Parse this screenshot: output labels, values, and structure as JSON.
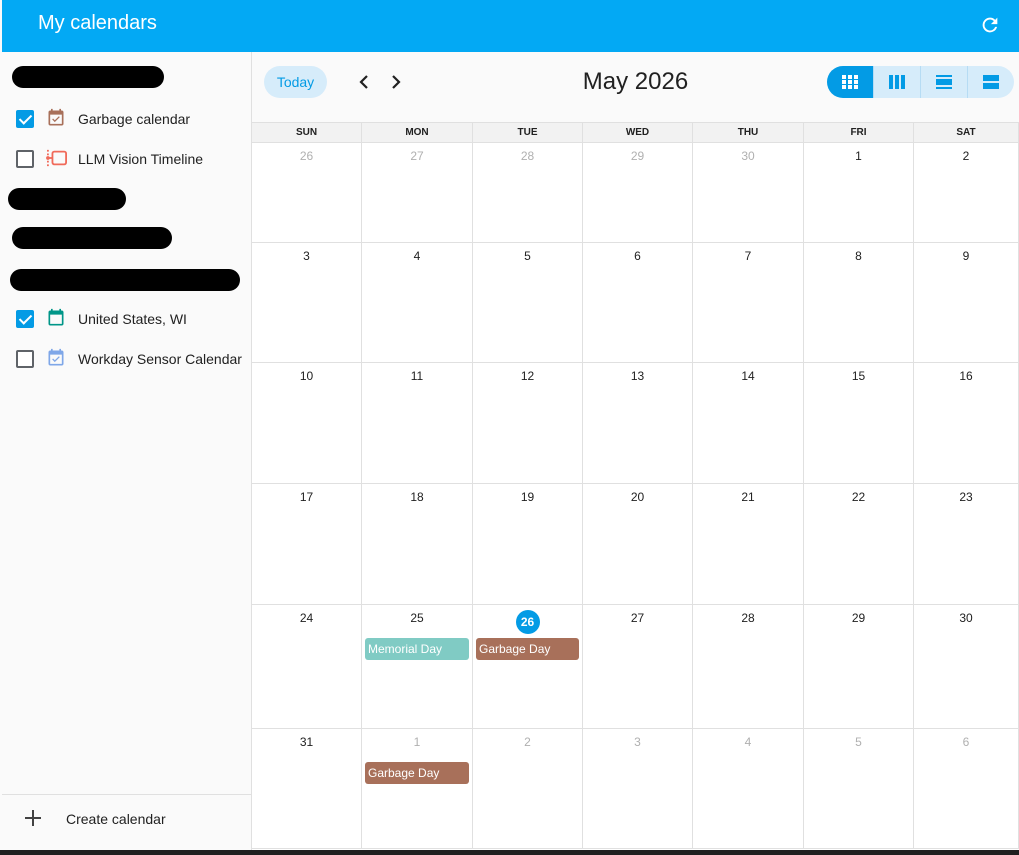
{
  "sidebar": {
    "title": "My calendars",
    "items": [
      {
        "label": "Garbage calendar",
        "checked": true,
        "icon": "calendar-check-icon",
        "color": "#a8705a"
      },
      {
        "label": "LLM Vision Timeline",
        "checked": false,
        "icon": "timeline-icon",
        "color": "#f06a5a"
      },
      {
        "label": "United States, WI",
        "checked": true,
        "icon": "calendar-icon",
        "color": "#009688"
      },
      {
        "label": "Workday Sensor Calendar",
        "checked": false,
        "icon": "calendar-check-icon",
        "color": "#7fa7e8"
      }
    ],
    "create_label": "Create calendar"
  },
  "toolbar": {
    "today_label": "Today",
    "month_title": "May 2026"
  },
  "colors": {
    "accent": "#03a9f4",
    "primary": "#039be5",
    "memorial": "#80cbc4",
    "garbage": "#a8705a"
  },
  "calendar": {
    "days_of_week": [
      "SUN",
      "MON",
      "TUE",
      "WED",
      "THU",
      "FRI",
      "SAT"
    ],
    "weeks": [
      [
        {
          "d": "26",
          "o": true
        },
        {
          "d": "27",
          "o": true
        },
        {
          "d": "28",
          "o": true
        },
        {
          "d": "29",
          "o": true
        },
        {
          "d": "30",
          "o": true
        },
        {
          "d": "1"
        },
        {
          "d": "2"
        }
      ],
      [
        {
          "d": "3"
        },
        {
          "d": "4"
        },
        {
          "d": "5"
        },
        {
          "d": "6"
        },
        {
          "d": "7"
        },
        {
          "d": "8"
        },
        {
          "d": "9"
        }
      ],
      [
        {
          "d": "10"
        },
        {
          "d": "11"
        },
        {
          "d": "12"
        },
        {
          "d": "13"
        },
        {
          "d": "14"
        },
        {
          "d": "15"
        },
        {
          "d": "16"
        }
      ],
      [
        {
          "d": "17"
        },
        {
          "d": "18"
        },
        {
          "d": "19"
        },
        {
          "d": "20"
        },
        {
          "d": "21"
        },
        {
          "d": "22"
        },
        {
          "d": "23"
        }
      ],
      [
        {
          "d": "24"
        },
        {
          "d": "25",
          "events": [
            {
              "title": "Memorial Day",
              "color": "#80cbc4"
            }
          ]
        },
        {
          "d": "26",
          "today": true,
          "events": [
            {
              "title": "Garbage Day",
              "color": "#a8705a"
            }
          ]
        },
        {
          "d": "27"
        },
        {
          "d": "28"
        },
        {
          "d": "29"
        },
        {
          "d": "30"
        }
      ],
      [
        {
          "d": "31"
        },
        {
          "d": "1",
          "o": true,
          "events": [
            {
              "title": "Garbage Day",
              "color": "#a8705a"
            }
          ]
        },
        {
          "d": "2",
          "o": true
        },
        {
          "d": "3",
          "o": true
        },
        {
          "d": "4",
          "o": true
        },
        {
          "d": "5",
          "o": true
        },
        {
          "d": "6",
          "o": true
        }
      ]
    ]
  }
}
